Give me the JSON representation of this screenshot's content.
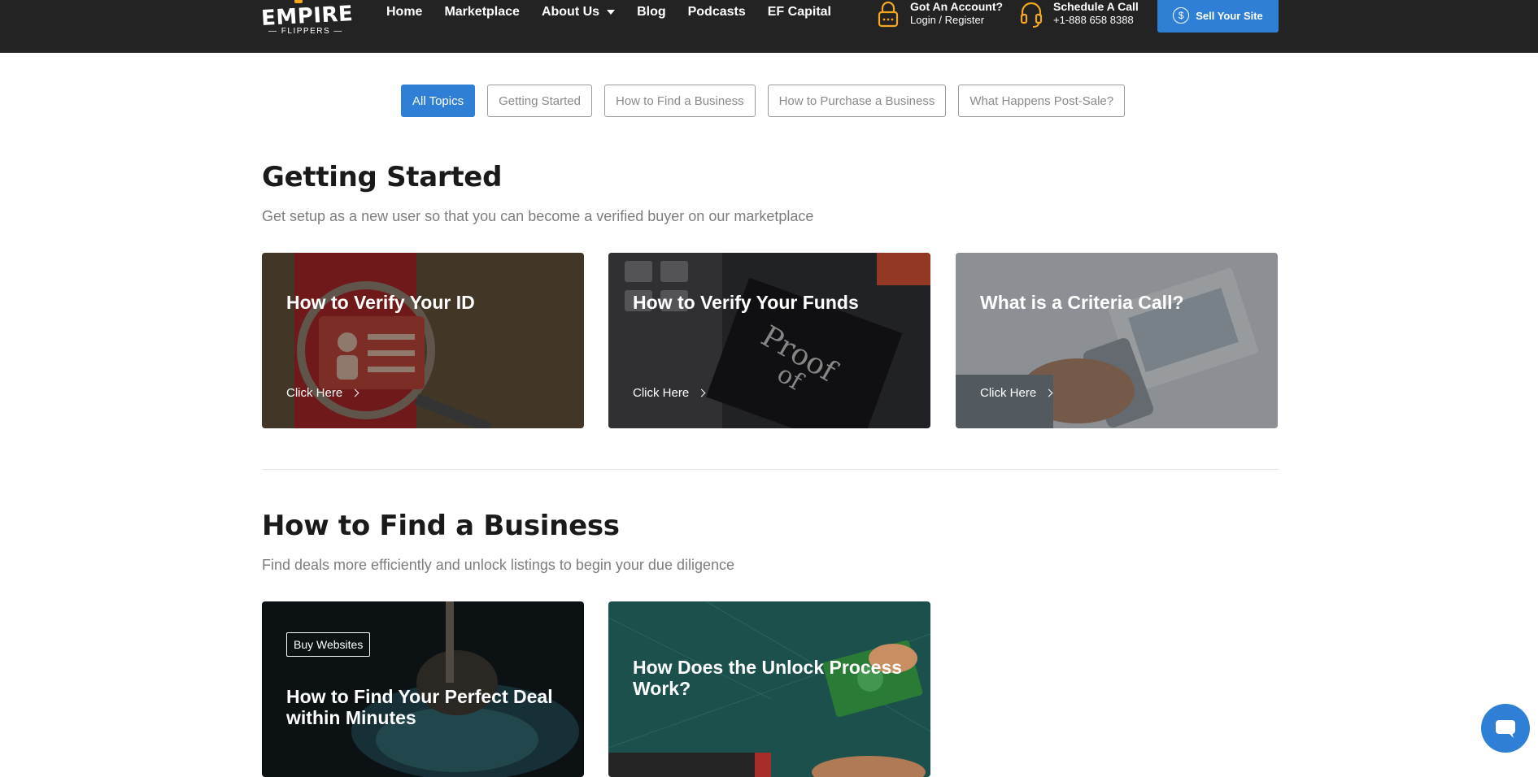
{
  "header": {
    "logo_text": "EMPIRE",
    "logo_sub": "— FLIPPERS —",
    "nav": [
      {
        "label": "Home"
      },
      {
        "label": "Marketplace"
      },
      {
        "label": "About Us"
      },
      {
        "label": "Blog"
      },
      {
        "label": "Podcasts"
      },
      {
        "label": "EF Capital"
      }
    ],
    "account": {
      "title": "Got An Account?",
      "link": "Login / Register",
      "icon": "lock-icon"
    },
    "call": {
      "title": "Schedule A Call",
      "phone": "+1-888 658 8388",
      "icon": "headset-icon"
    },
    "sell_button": {
      "label": "Sell Your Site",
      "icon": "dollar-circle-icon"
    },
    "accent_color": "#f5a623",
    "bar_color": "#232323"
  },
  "topics": [
    {
      "label": "All Topics",
      "active": true
    },
    {
      "label": "Getting Started",
      "active": false
    },
    {
      "label": "How to Find a Business",
      "active": false
    },
    {
      "label": "How to Purchase a Business",
      "active": false
    },
    {
      "label": "What Happens Post-Sale?",
      "active": false
    }
  ],
  "sections": [
    {
      "title": "Getting Started",
      "subtitle": "Get setup as a new user so that you can become a verified buyer on our marketplace",
      "cards": [
        {
          "title": "How to Verify Your ID",
          "link": "Click Here"
        },
        {
          "title": "How to Verify Your Funds",
          "link": "Click Here"
        },
        {
          "title": "What is a Criteria Call?",
          "link": "Click Here"
        }
      ]
    },
    {
      "title": "How to Find a Business",
      "subtitle": "Find deals more efficiently and unlock listings to begin your due diligence",
      "cards": [
        {
          "tag": "Buy Websites",
          "title": "How to Find Your Perfect Deal within Minutes"
        },
        {
          "title": "How Does the Unlock Process Work?"
        }
      ]
    }
  ],
  "primary_color": "#2f7fd6"
}
